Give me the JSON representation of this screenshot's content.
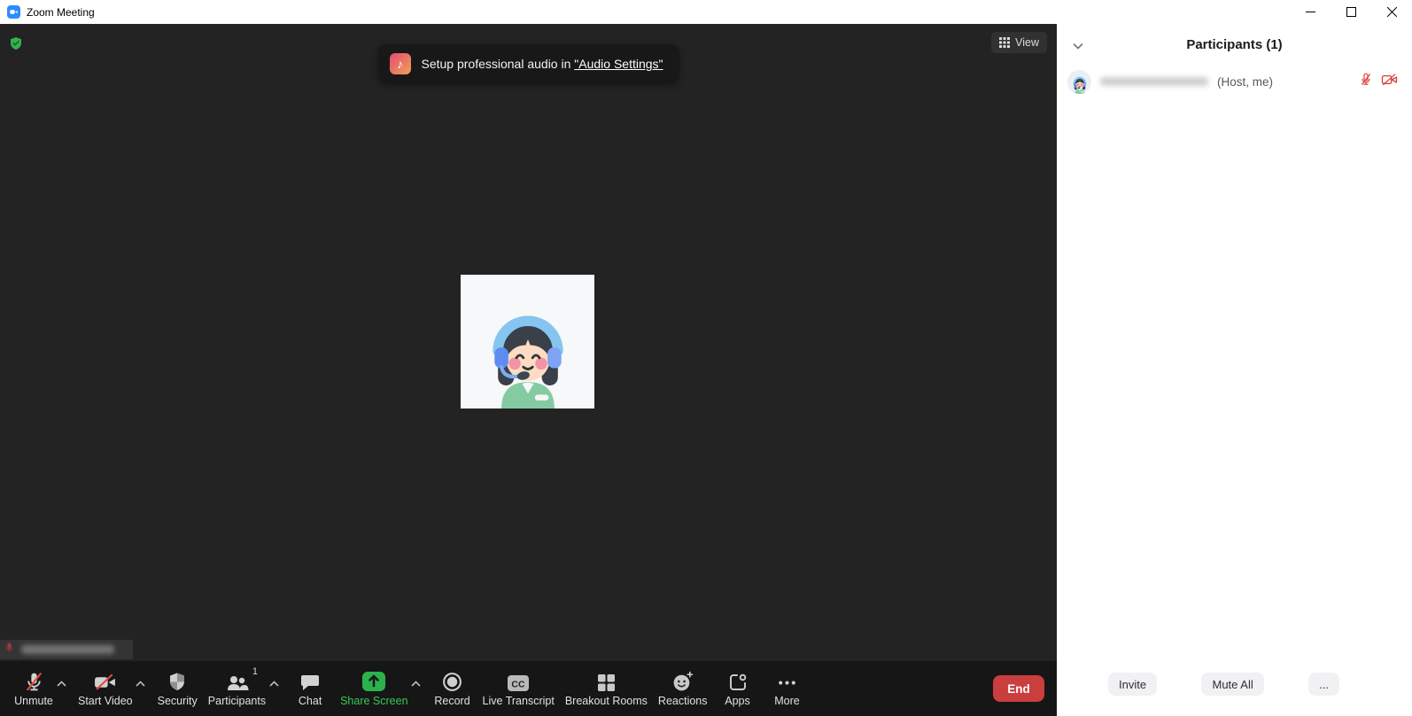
{
  "window": {
    "title": "Zoom Meeting",
    "control_icons": [
      "minimize-icon",
      "maximize-icon",
      "close-icon"
    ]
  },
  "stage": {
    "view_label": "View",
    "toast": {
      "prefix": "Setup professional audio in ",
      "link_text": "\"Audio Settings\"",
      "icon": "music-note-icon"
    },
    "badges": {
      "encryption_shield": "shield-check-icon"
    }
  },
  "toolbar": {
    "items": [
      {
        "label": "Unmute",
        "icon": "microphone-muted-icon",
        "has_caret": true
      },
      {
        "label": "Start Video",
        "icon": "camera-off-icon",
        "has_caret": true
      },
      {
        "label": "Security",
        "icon": "shield-icon",
        "has_caret": false
      },
      {
        "label": "Participants",
        "icon": "people-icon",
        "badge": "1",
        "has_caret": true
      },
      {
        "label": "Chat",
        "icon": "chat-bubble-icon",
        "has_caret": false
      },
      {
        "label": "Share Screen",
        "icon": "share-screen-icon",
        "has_caret": true
      },
      {
        "label": "Record",
        "icon": "record-icon",
        "has_caret": false
      },
      {
        "label": "Live Transcript",
        "icon": "cc-icon",
        "has_caret": false
      },
      {
        "label": "Breakout Rooms",
        "icon": "grid-2x2-icon",
        "has_caret": false
      },
      {
        "label": "Reactions",
        "icon": "smiley-plus-icon",
        "has_caret": false
      },
      {
        "label": "Apps",
        "icon": "apps-icon",
        "has_caret": false
      },
      {
        "label": "More",
        "icon": "ellipsis-icon",
        "has_caret": false
      }
    ],
    "end_label": "End"
  },
  "panel": {
    "title": "Participants (1)",
    "row": {
      "host_suffix": "(Host, me)",
      "status_icons": [
        "microphone-muted-red-icon",
        "camera-off-red-icon"
      ]
    },
    "footer": {
      "invite": "Invite",
      "mute_all": "Mute All",
      "more": "..."
    }
  },
  "colors": {
    "zoom_blue": "#2D8CFF",
    "shield_green": "#35b14e",
    "share_green_icon": "#2BB24C",
    "share_green_label": "#35cb51",
    "end_red": "#CA3E3E",
    "mute_red": "#D93B3B",
    "stage_bg": "#232323",
    "toolbar_bg": "#161616"
  }
}
